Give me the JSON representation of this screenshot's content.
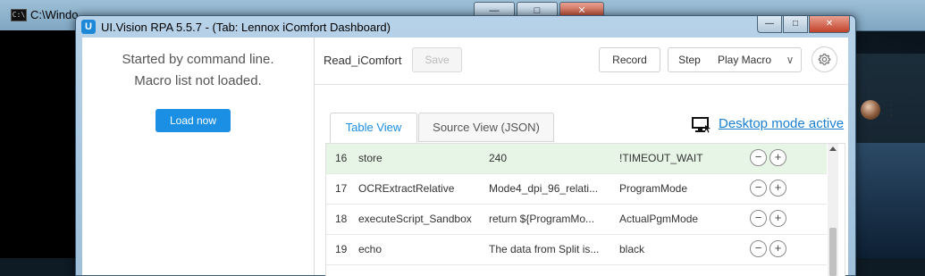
{
  "background_window": {
    "title": "C:\\Windo"
  },
  "window": {
    "title": "UI.Vision RPA 5.5.7 - (Tab: Lennox iComfort Dashboard)",
    "logo_letter": "U"
  },
  "left_panel": {
    "line1": "Started by command line.",
    "line2": "Macro list not loaded.",
    "load_button": "Load now"
  },
  "toolbar": {
    "macro_name": "Read_iComfort",
    "save_label": "Save",
    "record_label": "Record",
    "step_label": "Step",
    "play_label": "Play Macro",
    "dropdown_glyph": "∨"
  },
  "tabs": {
    "table_view": "Table View",
    "source_view": "Source View (JSON)"
  },
  "desktop_mode": {
    "label": "Desktop mode active"
  },
  "colors": {
    "accent": "#1a8fe3",
    "highlight_row": "#e6f5e6"
  },
  "rows": [
    {
      "index": "16",
      "command": "store",
      "target": "240",
      "value": "!TIMEOUT_WAIT"
    },
    {
      "index": "17",
      "command": "OCRExtractRelative",
      "target": "Mode4_dpi_96_relati...",
      "value": "ProgramMode"
    },
    {
      "index": "18",
      "command": "executeScript_Sandbox",
      "target": "return ${ProgramMo...",
      "value": "ActualPgmMode"
    },
    {
      "index": "19",
      "command": "echo",
      "target": "The data from Split is...",
      "value": "black"
    }
  ],
  "row_ops": {
    "minus": "−",
    "plus": "+"
  }
}
